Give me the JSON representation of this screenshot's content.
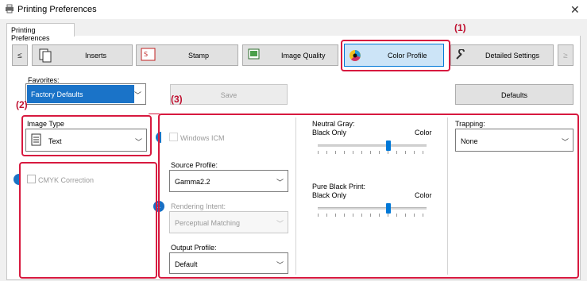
{
  "window": {
    "title": "Printing Preferences",
    "close_glyph": "✕",
    "icon": "printer-icon"
  },
  "tabs": [
    {
      "label": "Printing Preferences",
      "selected": true
    }
  ],
  "toolbar": {
    "prev_glyph": "≤",
    "next_glyph": "≥",
    "buttons": [
      {
        "label": "Inserts",
        "icon": "inserts-icon"
      },
      {
        "label": "Stamp",
        "icon": "stamp-icon"
      },
      {
        "label": "Image Quality",
        "icon": "image-quality-icon"
      },
      {
        "label": "Color Profile",
        "icon": "color-profile-icon",
        "selected": true
      },
      {
        "label": "Detailed Settings",
        "icon": "wrench-icon"
      }
    ]
  },
  "favorites": {
    "label": "Favorites:",
    "value": "Factory Defaults",
    "save_label": "Save",
    "defaults_label": "Defaults"
  },
  "image_type": {
    "label": "Image Type",
    "value": "Text",
    "icon": "document-icon"
  },
  "cmyk": {
    "label": "CMYK Correction",
    "checked": false
  },
  "icm": {
    "windows_icm_label": "Windows ICM",
    "source_profile_label": "Source Profile:",
    "source_profile_value": "Gamma2.2",
    "rendering_intent_label": "Rendering Intent:",
    "rendering_intent_value": "Perceptual Matching",
    "output_profile_label": "Output Profile:",
    "output_profile_value": "Default"
  },
  "neutral_gray": {
    "label": "Neutral Gray:",
    "left": "Black Only",
    "right": "Color",
    "level": 0.65
  },
  "pure_black": {
    "label": "Pure Black Print:",
    "left": "Black Only",
    "right": "Color",
    "level": 0.65
  },
  "trapping": {
    "label": "Trapping:",
    "value": "None"
  },
  "annotations": {
    "a1": "(1)",
    "a2": "(2)",
    "a3": "(3)"
  },
  "colors": {
    "highlight": "#d7193f",
    "accent": "#0078d7",
    "selection": "#1a73c8"
  }
}
